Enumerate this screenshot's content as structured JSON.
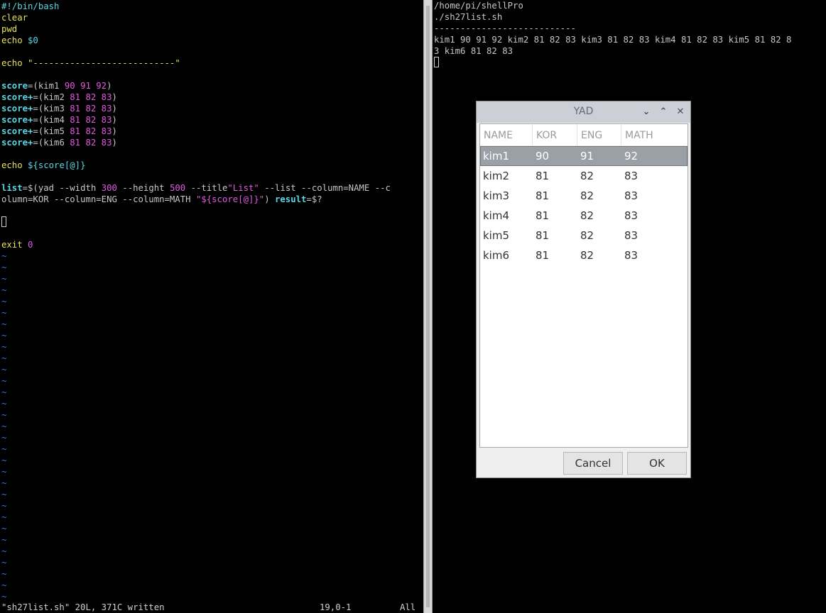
{
  "editor": {
    "lines": [
      {
        "segments": [
          {
            "t": "#!/bin/bash",
            "c": "cyan"
          }
        ]
      },
      {
        "segments": [
          {
            "t": "clear",
            "c": "yel"
          }
        ]
      },
      {
        "segments": [
          {
            "t": "pwd",
            "c": "yel"
          }
        ]
      },
      {
        "segments": [
          {
            "t": "echo ",
            "c": "yel"
          },
          {
            "t": "$0",
            "c": "cyan"
          }
        ]
      },
      {
        "segments": []
      },
      {
        "segments": [
          {
            "t": "echo ",
            "c": "yel"
          },
          {
            "t": "\"---------------------------\"",
            "c": "yel"
          }
        ]
      },
      {
        "segments": []
      },
      {
        "segments": [
          {
            "t": "score",
            "c": "bcyan"
          },
          {
            "t": "=(kim1 ",
            "c": ""
          },
          {
            "t": "90 91 92",
            "c": "mag"
          },
          {
            "t": ")",
            "c": ""
          }
        ]
      },
      {
        "segments": [
          {
            "t": "score+",
            "c": "bcyan"
          },
          {
            "t": "=(kim2 ",
            "c": ""
          },
          {
            "t": "81 82 83",
            "c": "mag"
          },
          {
            "t": ")",
            "c": ""
          }
        ]
      },
      {
        "segments": [
          {
            "t": "score+",
            "c": "bcyan"
          },
          {
            "t": "=(kim3 ",
            "c": ""
          },
          {
            "t": "81 82 83",
            "c": "mag"
          },
          {
            "t": ")",
            "c": ""
          }
        ]
      },
      {
        "segments": [
          {
            "t": "score+",
            "c": "bcyan"
          },
          {
            "t": "=(kim4 ",
            "c": ""
          },
          {
            "t": "81 82 83",
            "c": "mag"
          },
          {
            "t": ")",
            "c": ""
          }
        ]
      },
      {
        "segments": [
          {
            "t": "score+",
            "c": "bcyan"
          },
          {
            "t": "=(kim5 ",
            "c": ""
          },
          {
            "t": "81 82 83",
            "c": "mag"
          },
          {
            "t": ")",
            "c": ""
          }
        ]
      },
      {
        "segments": [
          {
            "t": "score+",
            "c": "bcyan"
          },
          {
            "t": "=(kim6 ",
            "c": ""
          },
          {
            "t": "81 82 83",
            "c": "mag"
          },
          {
            "t": ")",
            "c": ""
          }
        ]
      },
      {
        "segments": []
      },
      {
        "segments": [
          {
            "t": "echo ",
            "c": "yel"
          },
          {
            "t": "${score[@]}",
            "c": "cyan"
          }
        ]
      },
      {
        "segments": []
      },
      {
        "segments": [
          {
            "t": "list",
            "c": "bcyan"
          },
          {
            "t": "=$(",
            "c": ""
          },
          {
            "t": "yad --width ",
            "c": ""
          },
          {
            "t": "300",
            "c": "mag"
          },
          {
            "t": " --height ",
            "c": ""
          },
          {
            "t": "500",
            "c": "mag"
          },
          {
            "t": " --title",
            "c": ""
          },
          {
            "t": "\"List\"",
            "c": "mag"
          },
          {
            "t": " --list --column=NAME --c",
            "c": ""
          }
        ]
      },
      {
        "segments": [
          {
            "t": "olumn=KOR --column=ENG --column=MATH ",
            "c": ""
          },
          {
            "t": "\"${score[@]}\"",
            "c": "mag"
          },
          {
            "t": ") ",
            "c": ""
          },
          {
            "t": "result",
            "c": "bcyan"
          },
          {
            "t": "=$?",
            "c": ""
          }
        ]
      },
      {
        "segments": []
      },
      {
        "segments": [
          {
            "t": "CURSOR",
            "c": "cursor"
          }
        ]
      },
      {
        "segments": []
      },
      {
        "segments": [
          {
            "t": "exit ",
            "c": "yel"
          },
          {
            "t": "0",
            "c": "mag"
          }
        ]
      }
    ],
    "tilde": "~",
    "status_file": "\"sh27list.sh\" 20L, 371C written",
    "status_pos": "19,0-1",
    "status_all": "All"
  },
  "terminal": {
    "lines": [
      "/home/pi/shellPro",
      "./sh27list.sh",
      "---------------------------",
      "kim1 90 91 92 kim2 81 82 83 kim3 81 82 83 kim4 81 82 83 kim5 81 82 8",
      "3 kim6 81 82 83"
    ]
  },
  "dialog": {
    "title": "YAD",
    "columns": [
      "NAME",
      "KOR",
      "ENG",
      "MATH"
    ],
    "rows": [
      [
        "kim1",
        "90",
        "91",
        "92"
      ],
      [
        "kim2",
        "81",
        "82",
        "83"
      ],
      [
        "kim3",
        "81",
        "82",
        "83"
      ],
      [
        "kim4",
        "81",
        "82",
        "83"
      ],
      [
        "kim5",
        "81",
        "82",
        "83"
      ],
      [
        "kim6",
        "81",
        "82",
        "83"
      ]
    ],
    "selected_row": 0,
    "cancel_label": "Cancel",
    "ok_label": "OK",
    "minimize_glyph": "⌄",
    "maximize_glyph": "⌃",
    "close_glyph": "✕"
  }
}
